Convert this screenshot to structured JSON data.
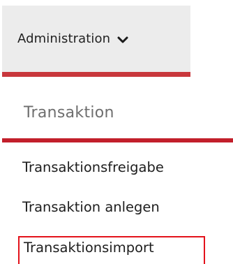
{
  "nav": {
    "admin_tab": {
      "label": "Administration",
      "icon": "chevron-down-icon",
      "accent_color": "#c8373c",
      "background_color": "#ececec"
    }
  },
  "submenu": {
    "section_title": "Transaktion",
    "rule_color": "#c21f2b",
    "items": [
      {
        "label": "Transaktionsfreigabe"
      },
      {
        "label": "Transaktion anlegen"
      },
      {
        "label": "Transaktionsimport",
        "highlight_color": "#e3121b"
      }
    ]
  }
}
